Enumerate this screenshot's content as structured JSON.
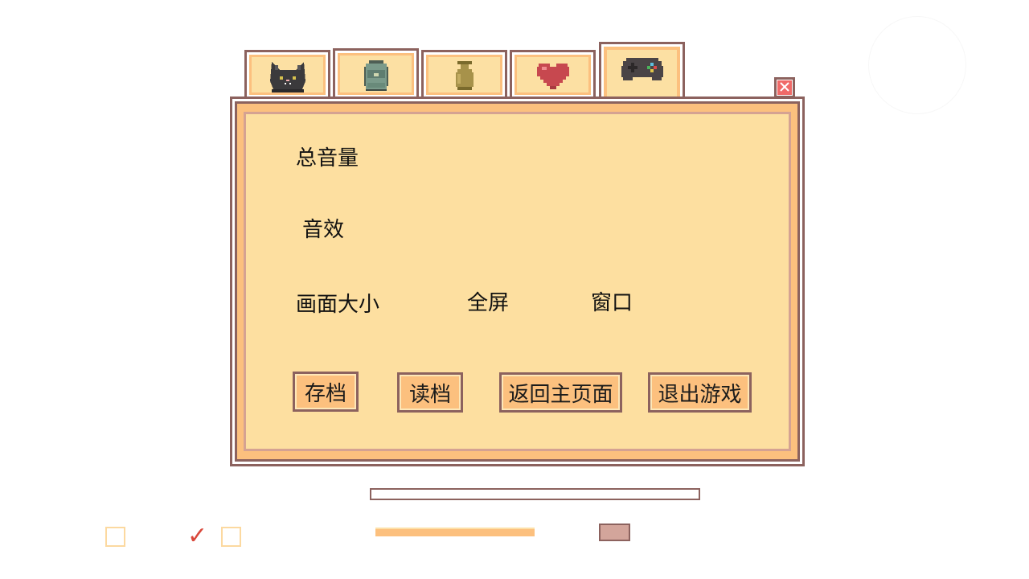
{
  "tabs": [
    {
      "id": "cat",
      "icon": "cat-icon",
      "active": false
    },
    {
      "id": "backpack",
      "icon": "backpack-icon",
      "active": false
    },
    {
      "id": "vase",
      "icon": "vase-icon",
      "active": false
    },
    {
      "id": "heart",
      "icon": "heart-icon",
      "active": false
    },
    {
      "id": "settings",
      "icon": "gamepad-icon",
      "active": true
    }
  ],
  "settings": {
    "master_volume_label": "总音量",
    "sfx_label": "音效",
    "screen_size_label": "画面大小",
    "fullscreen_option": "全屏",
    "window_option": "窗口"
  },
  "buttons": {
    "save": "存档",
    "load": "读档",
    "main_menu": "返回主页面",
    "quit": "退出游戏"
  },
  "controls": {
    "checkbox_1_checked": false,
    "checkbox_2_checked": true,
    "check_glyph": "✓"
  },
  "colors": {
    "panel_fill": "#fddfa0",
    "border": "#8c625e",
    "accent_orange": "#fcc07e",
    "close_red": "#f06a68",
    "check_red": "#d9473a"
  }
}
